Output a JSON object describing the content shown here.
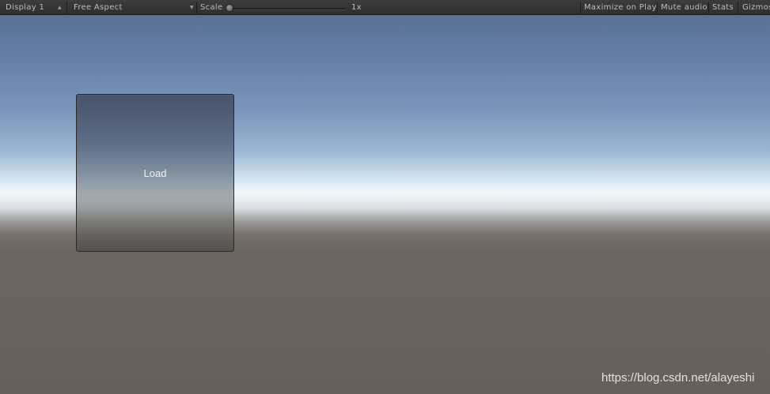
{
  "toolbar": {
    "display_label": "Display 1",
    "aspect_label": "Free Aspect",
    "scale_label": "Scale",
    "scale_value_label": "1x",
    "scale_value": 1,
    "maximize_label": "Maximize on Play",
    "mute_label": "Mute audio",
    "stats_label": "Stats",
    "gizmos_label": "Gizmos"
  },
  "scene": {
    "load_button_label": "Load"
  },
  "watermark": {
    "text": "https://blog.csdn.net/alayeshi"
  },
  "colors": {
    "toolbar_bg": "#333333",
    "sky_top": "#5a7095",
    "horizon": "#f3f8fb",
    "ground": "#6b6560",
    "button_text": "#f2f2f2"
  },
  "icons": {
    "display_dropdown": "dropdown-updown-icon",
    "aspect_dropdown": "dropdown-down-icon"
  }
}
